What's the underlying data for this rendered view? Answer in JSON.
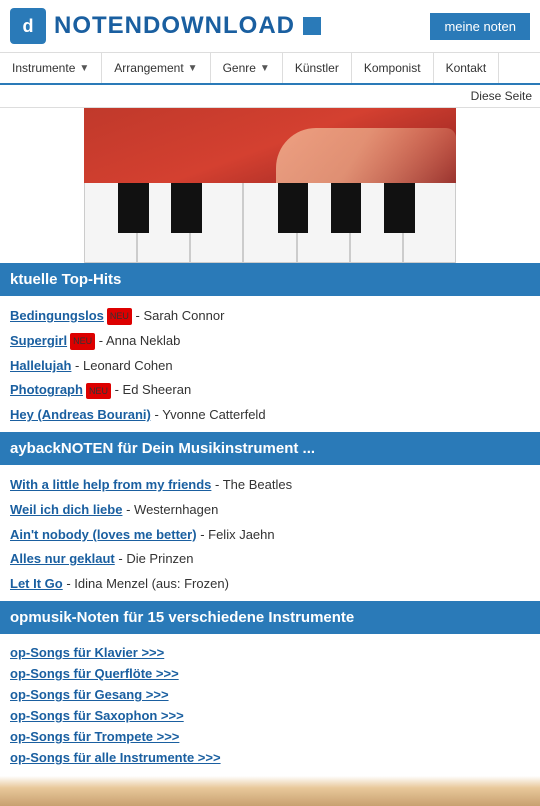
{
  "header": {
    "logo_letter": "d",
    "logo_title": "NOTENDOWNLOAD",
    "meine_noten_label": "meine noten"
  },
  "nav": {
    "items": [
      {
        "label": "Instrumente",
        "has_chevron": true
      },
      {
        "label": "Arrangement",
        "has_chevron": true
      },
      {
        "label": "Genre",
        "has_chevron": true
      },
      {
        "label": "Künstler",
        "has_chevron": false
      },
      {
        "label": "Komponist",
        "has_chevron": false
      },
      {
        "label": "Kontakt",
        "has_chevron": false
      }
    ]
  },
  "diese_seite_label": "Diese Seite",
  "sections": {
    "top_hits": {
      "header": "ktuelle Top-Hits",
      "items": [
        {
          "title": "Bedingungslos",
          "artist": "Sarah Connor",
          "badge": "NEU"
        },
        {
          "title": "Supergirl",
          "artist": "Anna Neklab",
          "badge": "NEU"
        },
        {
          "title": "Hallelujah",
          "artist": "Leonard Cohen",
          "badge": ""
        },
        {
          "title": "Photograph",
          "artist": "Ed Sheeran",
          "badge": "NEU"
        },
        {
          "title": "Hey (Andreas Bourani)",
          "artist": "Yvonne Catterfeld",
          "badge": ""
        }
      ]
    },
    "playback": {
      "header": "aybackNOTEN für Dein Musikinstrument ...",
      "items": [
        {
          "title": "With a little help from my friends",
          "artist": "The Beatles"
        },
        {
          "title": "Weil ich dich liebe",
          "artist": "Westernhagen"
        },
        {
          "title": "Ain't nobody (loves me better)",
          "artist": "Felix Jaehn"
        },
        {
          "title": "Alles nur geklaut",
          "artist": "Die Prinzen"
        },
        {
          "title": "Let It Go",
          "artist": "Idina Menzel (aus: Frozen)"
        }
      ]
    },
    "instruments": {
      "header": "opmusik-Noten für 15 verschiedene Instrumente",
      "links": [
        "op-Songs für Klavier >>>",
        "op-Songs für Querflöte >>>",
        "op-Songs für Gesang >>>",
        "op-Songs für Saxophon >>>",
        "op-Songs für Trompete >>>",
        "op-Songs für alle Instrumente >>>"
      ]
    }
  }
}
